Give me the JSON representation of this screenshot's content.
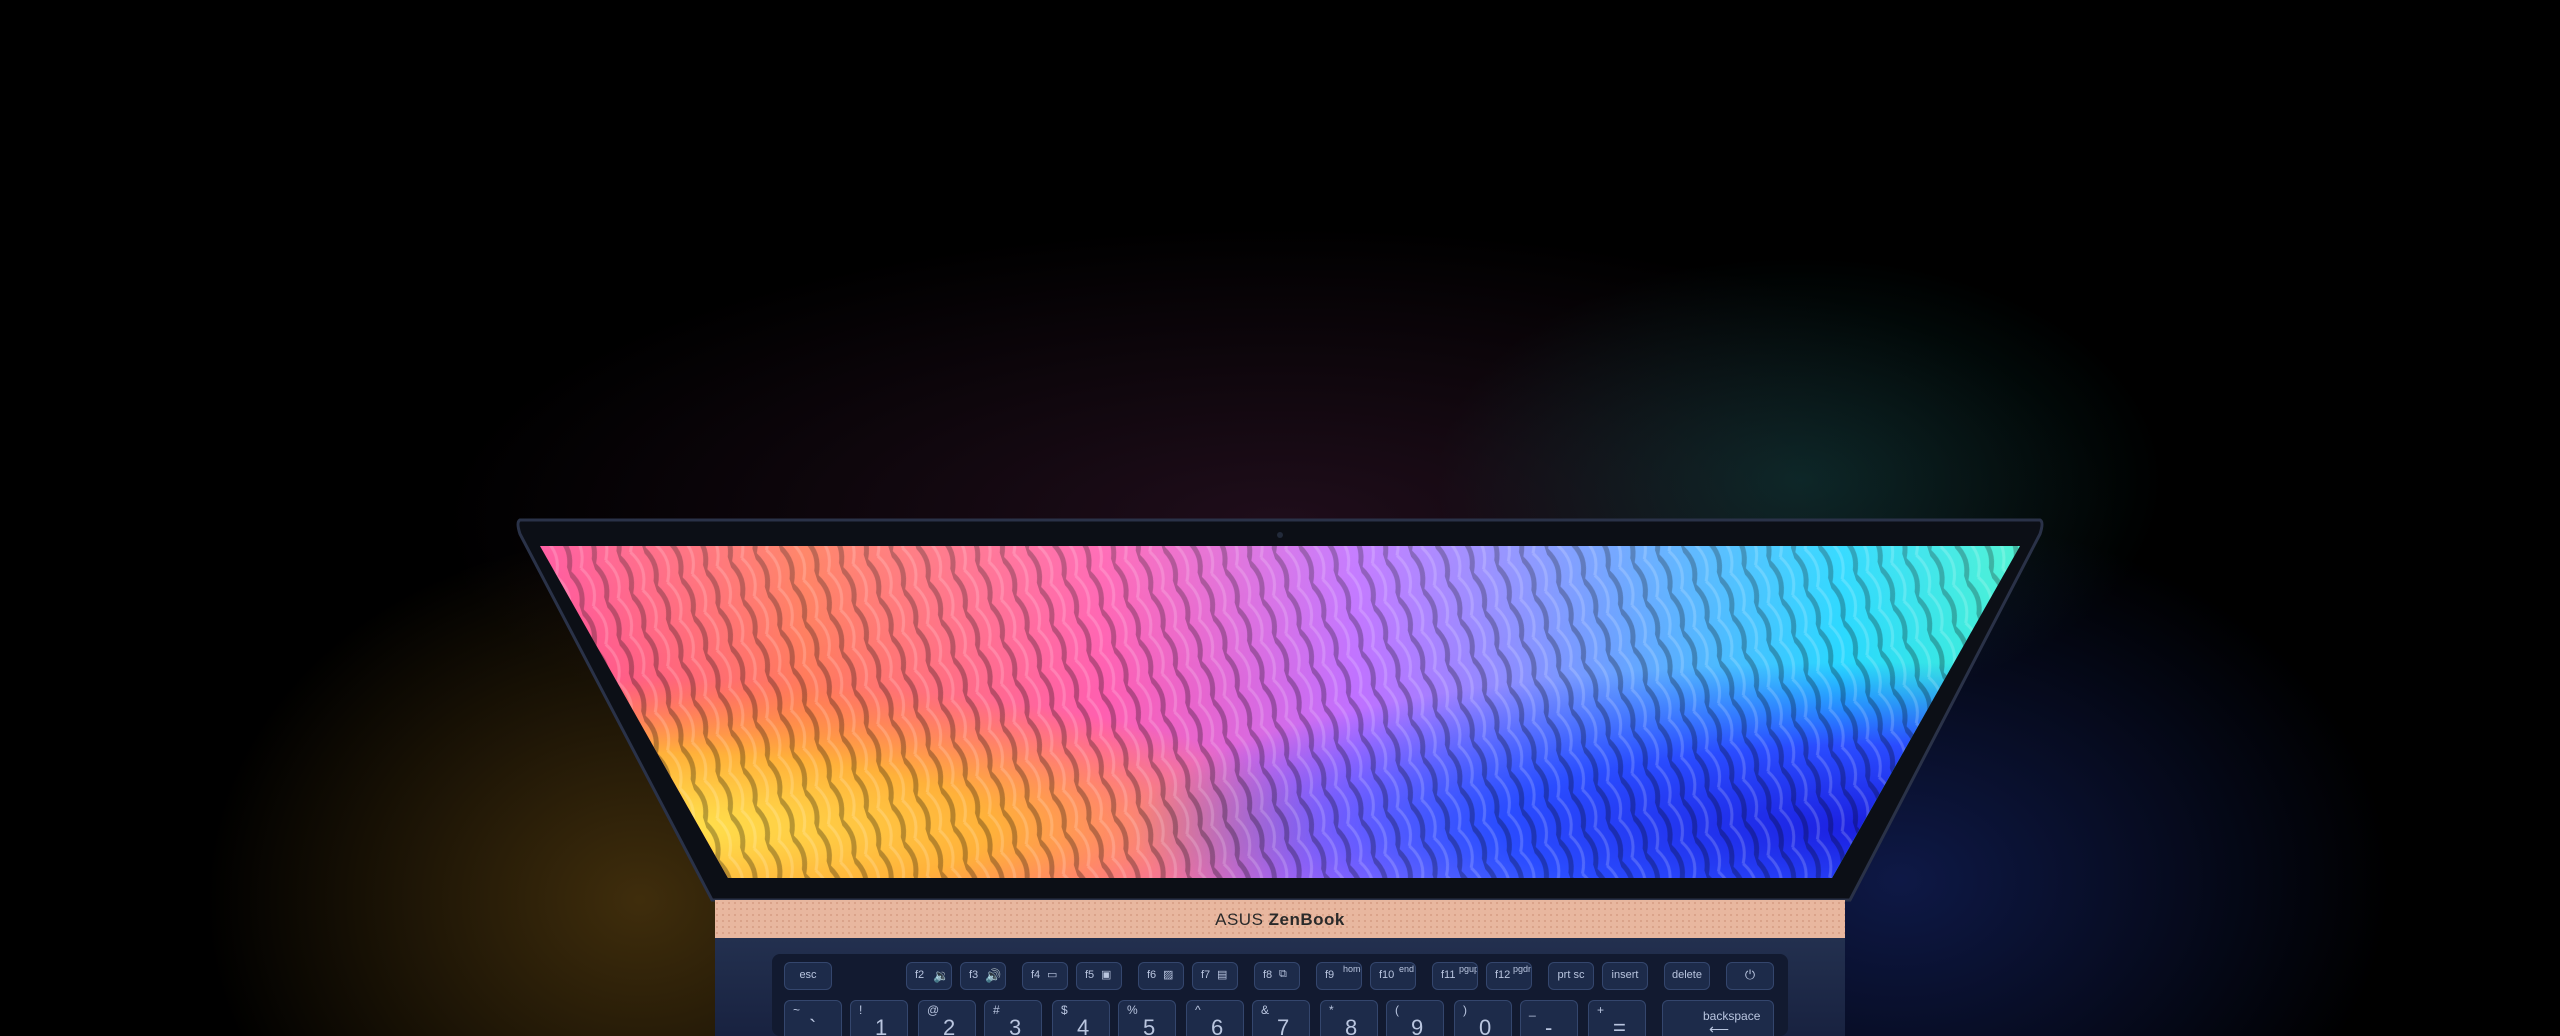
{
  "brand": {
    "prefix": "ASUS",
    "name": "ZenBook"
  },
  "keyboard": {
    "function_row": [
      {
        "label": "esc"
      },
      {
        "label": "f2",
        "icon": "volume-down-icon"
      },
      {
        "label": "f3",
        "icon": "volume-up-icon"
      },
      {
        "label": "f4",
        "icon": "keyboard-backlight-down-icon"
      },
      {
        "label": "f5",
        "icon": "keyboard-backlight-up-icon"
      },
      {
        "label": "f6",
        "icon": "touchpad-toggle-icon"
      },
      {
        "label": "f7",
        "icon": "display-off-icon"
      },
      {
        "label": "f8",
        "icon": "display-switch-icon"
      },
      {
        "label": "f9",
        "alt": "home"
      },
      {
        "label": "f10",
        "alt": "end"
      },
      {
        "label": "f11",
        "alt": "pgup"
      },
      {
        "label": "f12",
        "alt": "pgdn"
      },
      {
        "label": "prt sc"
      },
      {
        "label": "insert"
      },
      {
        "label": "delete"
      },
      {
        "label": "⏻",
        "icon": "power-icon"
      }
    ],
    "number_row": [
      {
        "shift": "~",
        "main": "`"
      },
      {
        "shift": "!",
        "main": "1"
      },
      {
        "shift": "@",
        "main": "2"
      },
      {
        "shift": "#",
        "main": "3"
      },
      {
        "shift": "$",
        "main": "4"
      },
      {
        "shift": "%",
        "main": "5"
      },
      {
        "shift": "^",
        "main": "6"
      },
      {
        "shift": "&",
        "main": "7"
      },
      {
        "shift": "*",
        "main": "8"
      },
      {
        "shift": "(",
        "main": "9"
      },
      {
        "shift": ")",
        "main": "0"
      },
      {
        "shift": "_",
        "main": "-"
      },
      {
        "shift": "+",
        "main": "="
      },
      {
        "shift": "",
        "main": "backspace"
      }
    ]
  },
  "colors": {
    "chassis": "#1c2744",
    "hinge": "#e9b9a0",
    "bezel": "#0c0f16",
    "key": "#1d2b4a",
    "legend": "#b9c5df"
  }
}
